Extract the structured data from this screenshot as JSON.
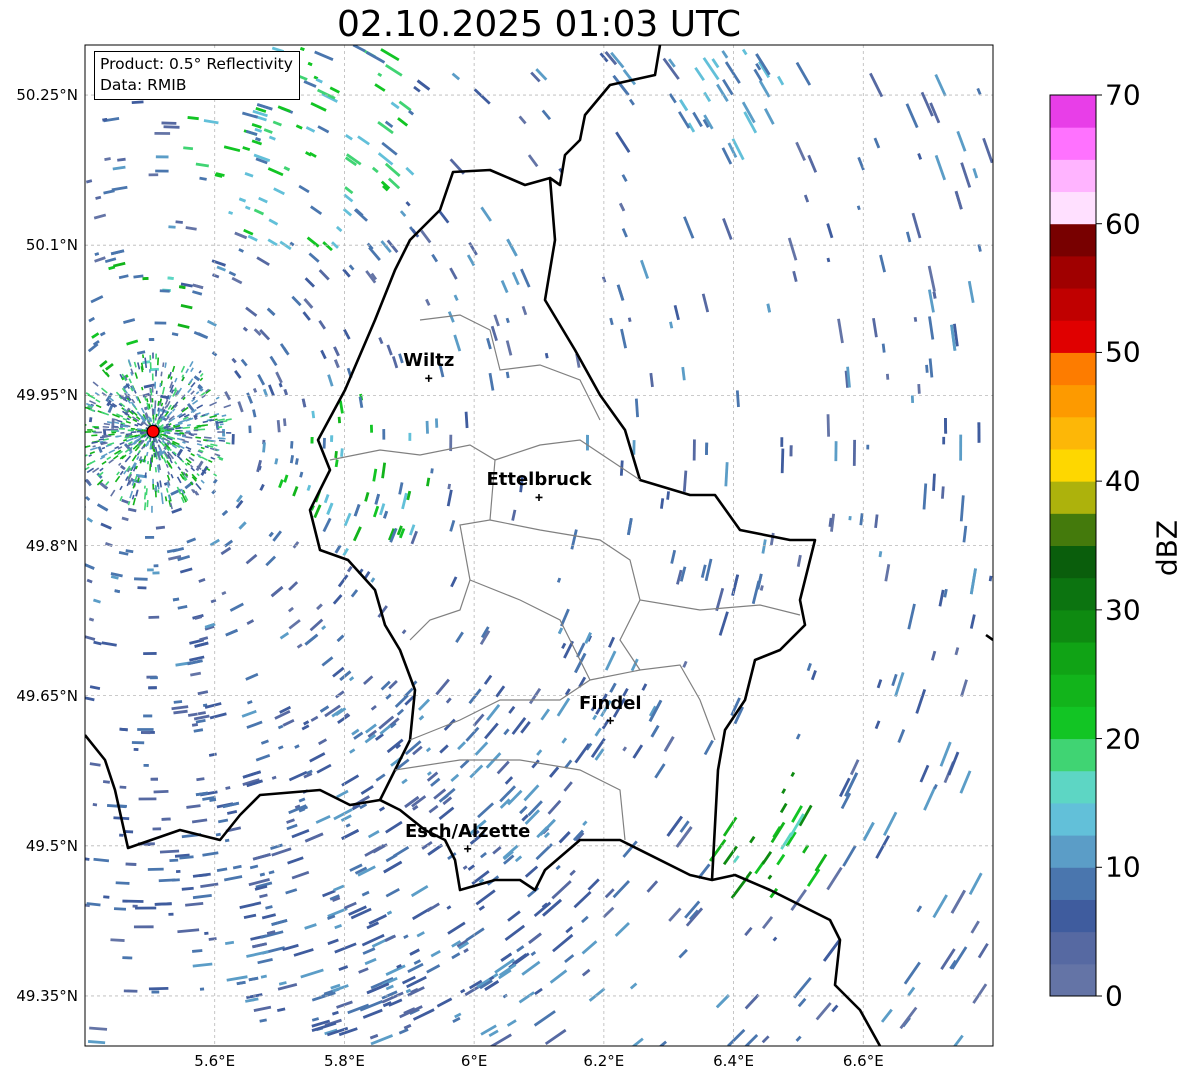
{
  "title": "02.10.2025 01:03 UTC",
  "info": {
    "product": "Product: 0.5° Reflectivity",
    "source": "Data: RMIB"
  },
  "axes": {
    "lon_range": [
      5.4,
      6.8
    ],
    "lat_range": [
      49.3,
      50.3
    ],
    "x_ticks": [
      {
        "value": 5.6,
        "label": "5.6°E"
      },
      {
        "value": 5.8,
        "label": "5.8°E"
      },
      {
        "value": 6.0,
        "label": "6°E"
      },
      {
        "value": 6.2,
        "label": "6.2°E"
      },
      {
        "value": 6.4,
        "label": "6.4°E"
      },
      {
        "value": 6.6,
        "label": "6.6°E"
      }
    ],
    "y_ticks": [
      {
        "value": 50.25,
        "label": "50.25°N"
      },
      {
        "value": 50.1,
        "label": "50.1°N"
      },
      {
        "value": 49.95,
        "label": "49.95°N"
      },
      {
        "value": 49.8,
        "label": "49.8°N"
      },
      {
        "value": 49.65,
        "label": "49.65°N"
      },
      {
        "value": 49.5,
        "label": "49.5°N"
      },
      {
        "value": 49.35,
        "label": "49.35°N"
      }
    ],
    "grid": true
  },
  "cities": [
    {
      "name": "Wiltz",
      "lon": 5.93,
      "lat": 49.967
    },
    {
      "name": "Ettelbruck",
      "lon": 6.1,
      "lat": 49.848
    },
    {
      "name": "Findel",
      "lon": 6.21,
      "lat": 49.625
    },
    {
      "name": "Esch/Alzette",
      "lon": 5.99,
      "lat": 49.497
    }
  ],
  "radar_site": {
    "lon": 5.505,
    "lat": 49.914,
    "color": "#ff0000"
  },
  "colorbar": {
    "label": "dBZ",
    "min": 0,
    "max": 70,
    "ticks": [
      {
        "value": 0,
        "label": "0"
      },
      {
        "value": 10,
        "label": "10"
      },
      {
        "value": 20,
        "label": "20"
      },
      {
        "value": 30,
        "label": "30"
      },
      {
        "value": 40,
        "label": "40"
      },
      {
        "value": 50,
        "label": "50"
      },
      {
        "value": 60,
        "label": "60"
      },
      {
        "value": 70,
        "label": "70"
      }
    ],
    "colors": [
      "#6474a6",
      "#5669a2",
      "#3f5c9e",
      "#4a76ae",
      "#5b9dc7",
      "#62c0d9",
      "#5dd6c4",
      "#40d473",
      "#12c524",
      "#12b41b",
      "#10a315",
      "#0e8a11",
      "#0c7410",
      "#0a5e0c",
      "#447a0c",
      "#adb20c",
      "#fed700",
      "#fdb707",
      "#fd9a00",
      "#fd7c00",
      "#e00000",
      "#c00000",
      "#a00000",
      "#780000",
      "#ffe0ff",
      "#ffb4ff",
      "#ff72ff",
      "#e83ee8"
    ]
  },
  "borders": {
    "country_color": "#000000",
    "district_color": "#808080"
  }
}
